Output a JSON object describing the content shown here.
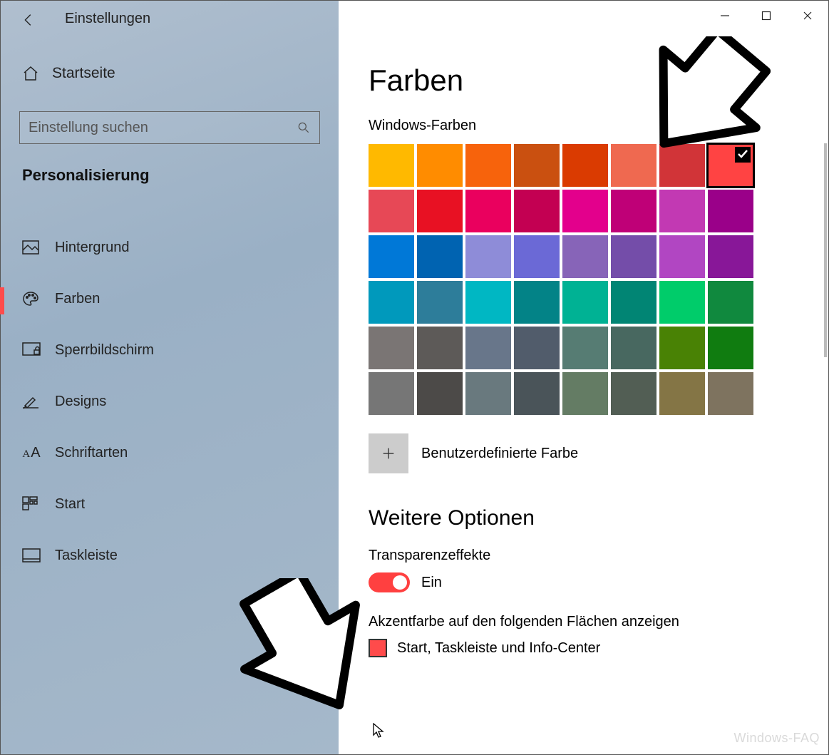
{
  "window": {
    "title": "Einstellungen",
    "watermark": "Windows-FAQ"
  },
  "sidebar": {
    "home": "Startseite",
    "search_placeholder": "Einstellung suchen",
    "category": "Personalisierung",
    "items": [
      {
        "label": "Hintergrund",
        "icon": "image-icon",
        "active": false
      },
      {
        "label": "Farben",
        "icon": "palette-icon",
        "active": true
      },
      {
        "label": "Sperrbildschirm",
        "icon": "lockscreen-icon",
        "active": false
      },
      {
        "label": "Designs",
        "icon": "brush-icon",
        "active": false
      },
      {
        "label": "Schriftarten",
        "icon": "font-icon",
        "active": false
      },
      {
        "label": "Start",
        "icon": "start-icon",
        "active": false
      },
      {
        "label": "Taskleiste",
        "icon": "taskbar-icon",
        "active": false
      }
    ]
  },
  "main": {
    "heading": "Farben",
    "palette_label": "Windows-Farben",
    "colors": [
      [
        "#FFB900",
        "#FF8C00",
        "#F7630C",
        "#CA5010",
        "#DA3B01",
        "#EF6950",
        "#D13438",
        "#FF4343"
      ],
      [
        "#E74856",
        "#E81123",
        "#EA005E",
        "#C30052",
        "#E3008C",
        "#BF0077",
        "#C239B3",
        "#9A0089"
      ],
      [
        "#0078D7",
        "#0063B1",
        "#8E8CD8",
        "#6B69D6",
        "#8764B8",
        "#744DA9",
        "#B146C2",
        "#881798"
      ],
      [
        "#0099BC",
        "#2D7D9A",
        "#00B7C3",
        "#038387",
        "#00B294",
        "#018574",
        "#00CC6A",
        "#10893E"
      ],
      [
        "#7A7574",
        "#5D5A58",
        "#68768A",
        "#515C6B",
        "#567C73",
        "#486860",
        "#498205",
        "#107C10"
      ],
      [
        "#767676",
        "#4C4A48",
        "#69797E",
        "#4A5459",
        "#647C64",
        "#525E54",
        "#847545",
        "#7E735F"
      ]
    ],
    "selected_index": [
      0,
      7
    ],
    "custom_color_label": "Benutzerdefinierte Farbe",
    "more_options": "Weitere Optionen",
    "transparency_label": "Transparenzeffekte",
    "transparency_state": "Ein",
    "accent_heading": "Akzentfarbe auf den folgenden Flächen anzeigen",
    "accent_option1": "Start, Taskleiste und Info-Center"
  }
}
